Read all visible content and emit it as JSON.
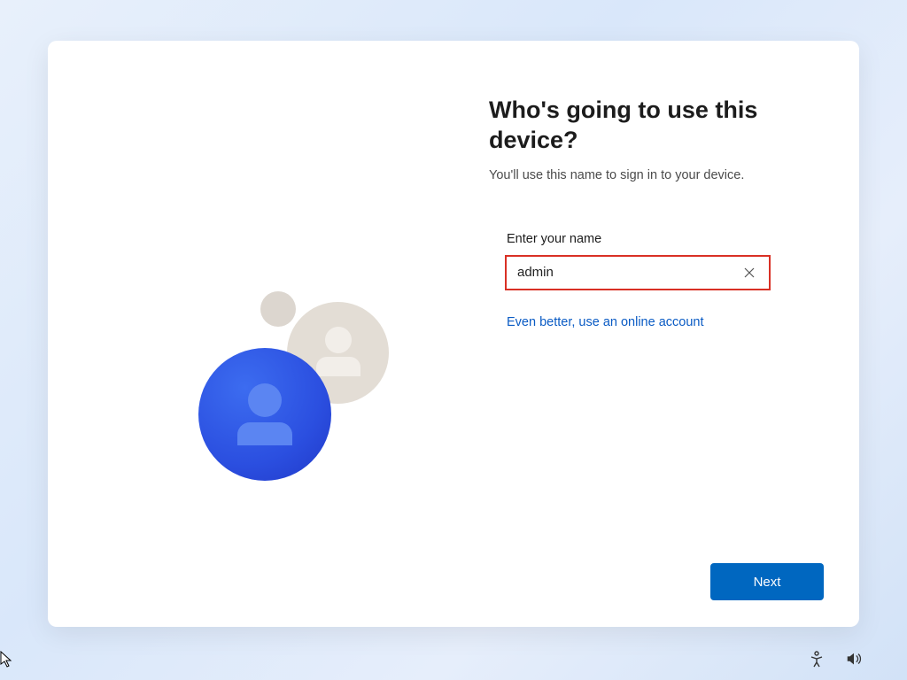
{
  "heading": "Who's going to use this device?",
  "subheading": "You'll use this name to sign in to your device.",
  "field_label": "Enter your name",
  "name_value": "admin",
  "online_link": "Even better, use an online account",
  "next_label": "Next",
  "icons": {
    "clear": "close-icon",
    "accessibility": "accessibility-icon",
    "volume": "volume-icon"
  },
  "colors": {
    "accent": "#0067c0",
    "error_border": "#d93025",
    "link": "#0a5bc4"
  }
}
